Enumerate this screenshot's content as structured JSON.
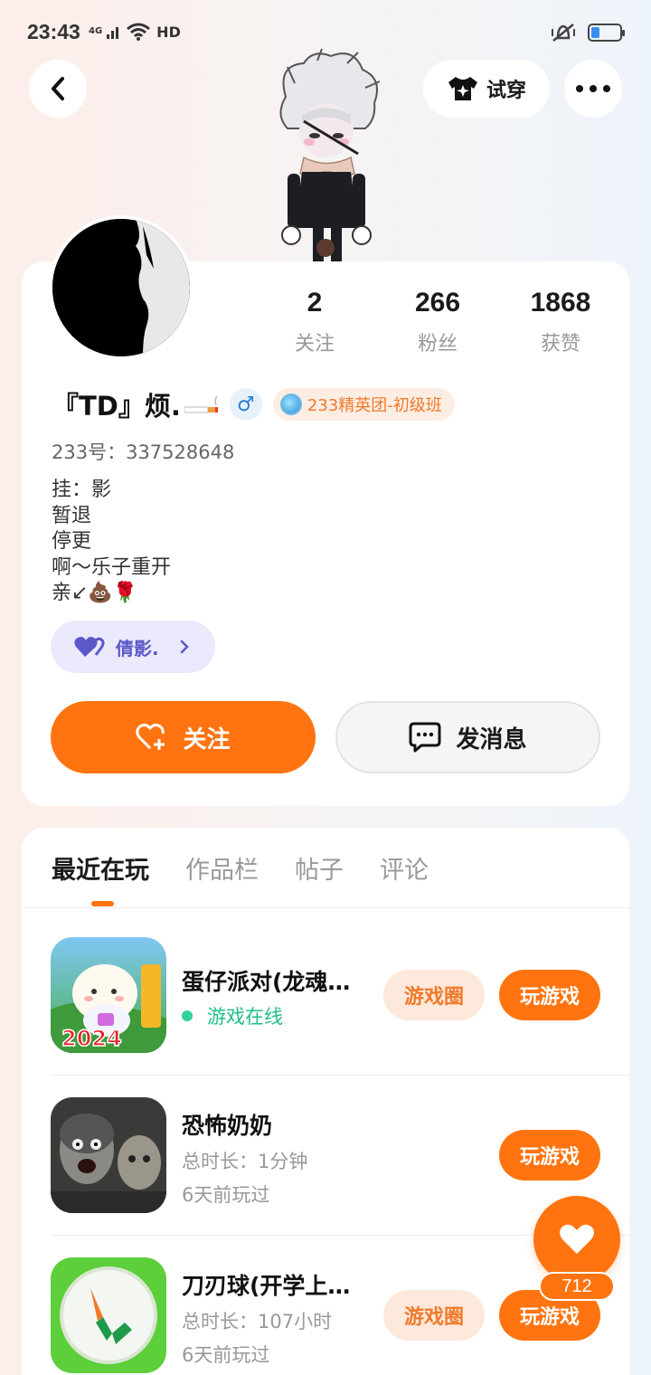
{
  "status_bar": {
    "time": "23:43",
    "network": "4G",
    "hd": "HD",
    "battery_level": 0.3
  },
  "header": {
    "back_icon": "chevron-left-icon",
    "tryon_label": "试穿",
    "tryon_icon": "tshirt-icon",
    "more_icon": "more-dots-icon"
  },
  "profile": {
    "stats": [
      {
        "value": "2",
        "label": "关注"
      },
      {
        "value": "266",
        "label": "粉丝"
      },
      {
        "value": "1868",
        "label": "获赞"
      }
    ],
    "name": "『TD』烦.",
    "gender": "♂",
    "rank": "233精英团-初级班",
    "uid": "233号：337528648",
    "bio_lines": [
      "挂：影",
      "暂退",
      "停更",
      "啊～乐子重开",
      "亲↙💩🌹"
    ],
    "cp_name": "倩影.",
    "follow_label": "关注",
    "message_label": "发消息"
  },
  "tabs": [
    "最近在玩",
    "作品栏",
    "帖子",
    "评论"
  ],
  "games": [
    {
      "title": "蛋仔派对(龙魂…",
      "online_text": "游戏在线",
      "circle_label": "游戏圈",
      "play_label": "玩游戏"
    },
    {
      "title": "恐怖奶奶",
      "duration": "总时长：1分钟",
      "last_played": "6天前玩过",
      "play_label": "玩游戏"
    },
    {
      "title": "刀刃球(开学上…",
      "duration": "总时长：107小时",
      "last_played": "6天前玩过",
      "circle_label": "游戏圈",
      "play_label": "玩游戏"
    }
  ],
  "fab": {
    "count": "712"
  },
  "colors": {
    "accent": "#ff7410",
    "online": "#1fbf86",
    "cp": "#5b58c9"
  }
}
